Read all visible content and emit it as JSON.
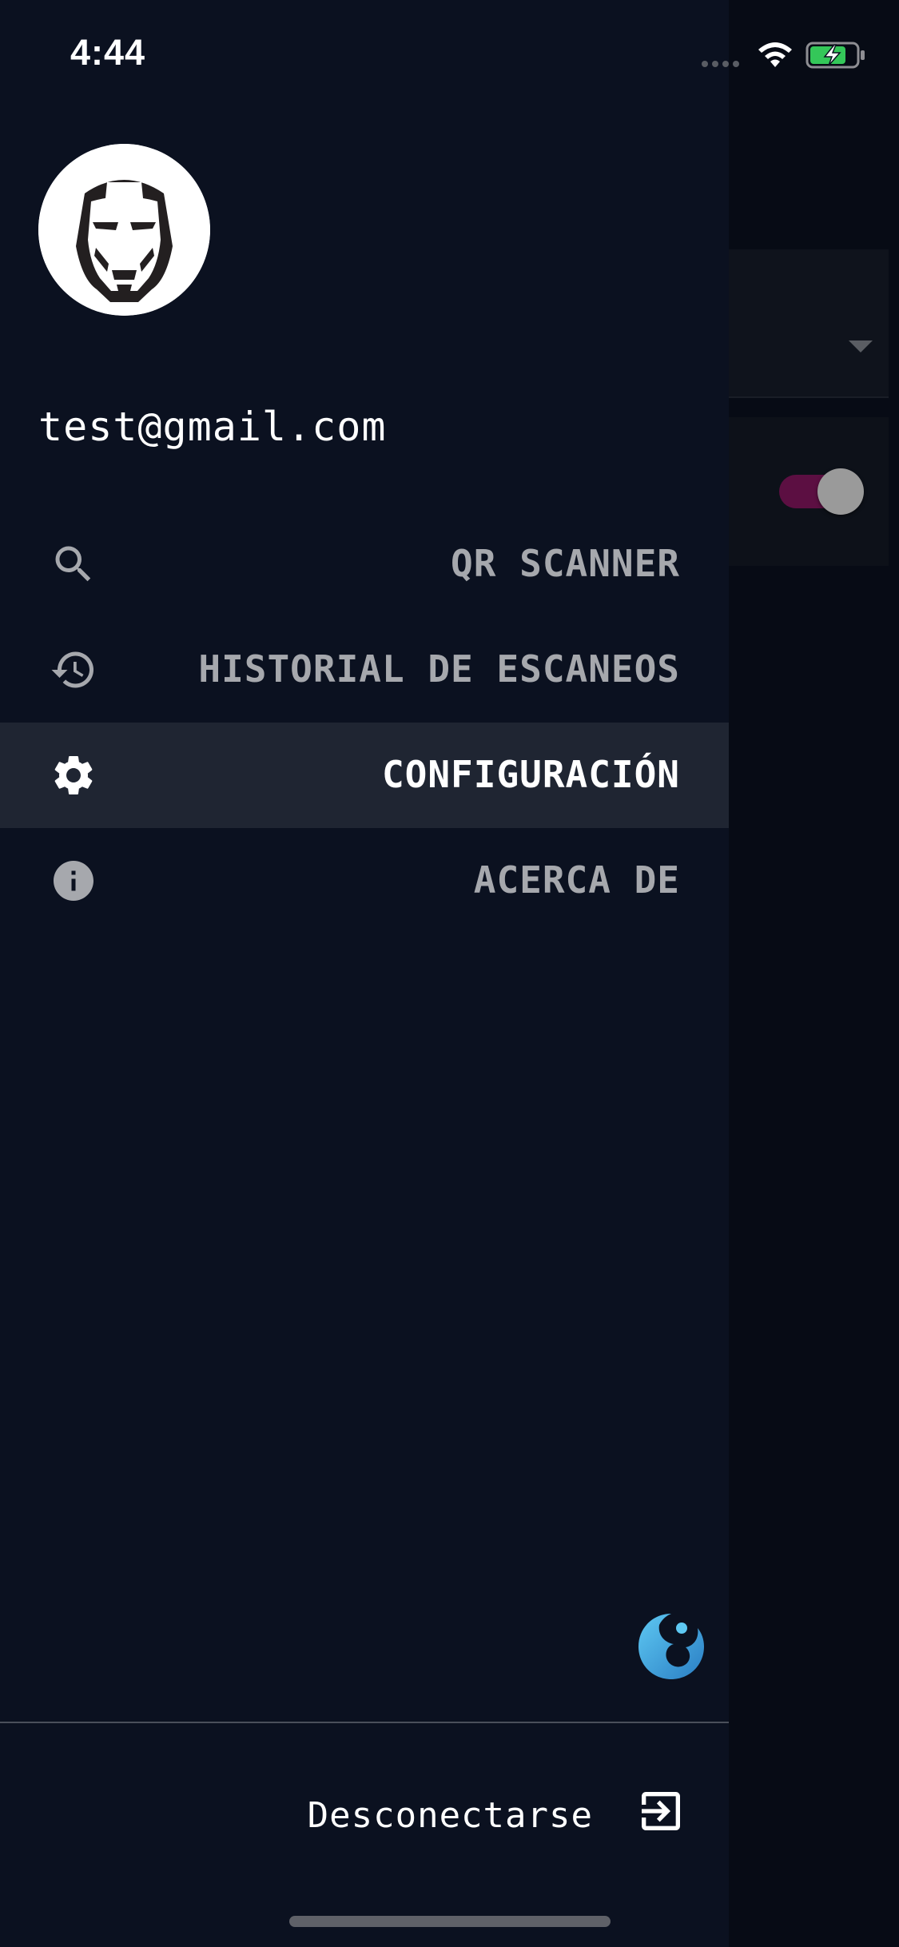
{
  "status_bar": {
    "time": "4:44",
    "wifi_icon": "wifi-icon",
    "battery_icon": "battery-charging-icon",
    "battery_color": "#34c759"
  },
  "drawer": {
    "avatar_icon": "iron-man-mask-icon",
    "user_email": "test@gmail.com",
    "menu": [
      {
        "label": "QR SCANNER",
        "icon": "search-icon",
        "active": false
      },
      {
        "label": "HISTORIAL DE ESCANEOS",
        "icon": "history-icon",
        "active": false
      },
      {
        "label": "CONFIGURACIÓN",
        "icon": "gear-icon",
        "active": true
      },
      {
        "label": "ACERCA DE",
        "icon": "info-icon",
        "active": false
      }
    ],
    "brand_icon": "brand-logo-icon",
    "logout": {
      "label": "Desconectarse",
      "icon": "logout-icon"
    }
  },
  "background_page": {
    "toggle_state": "on",
    "toggle_track_color": "#5c0f42"
  },
  "colors": {
    "drawer_bg": "#0b1120",
    "active_item_bg": "#1f2532",
    "inactive_text": "#a6a8ad",
    "active_text": "#ffffff"
  }
}
